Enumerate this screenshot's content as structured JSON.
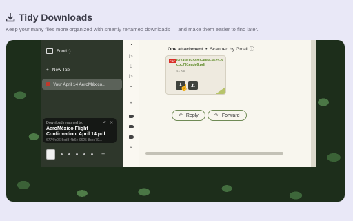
{
  "header": {
    "title": "Tidy Downloads",
    "subtitle": "Keep your many files more organized with smartly renamed downloads — and make them easier to find later.",
    "icon": "download-icon"
  },
  "sidebar": {
    "folder_label": "Food :)",
    "new_tab_label": "New Tab",
    "active_tab_label": "Your April 14 AeroMéxico..."
  },
  "toast": {
    "caption": "Download renamed to:",
    "title": "AeroMéxico Flight Confirmation, April 14.pdf",
    "original_name": "6774fe06-5cd3-4b6e-9625-8cbc79..."
  },
  "mail": {
    "attachment_heading": "One attachment",
    "scan_note": "Scanned by Gmail",
    "attachment_name": "6774fe06-5cd3-4b6e-9625-8cbc791eade6.pdf",
    "attachment_size": "41 KB",
    "file_type": "PDF",
    "reply_label": "Reply",
    "forward_label": "Forward"
  },
  "colors": {
    "page_bg": "#e9e8f7",
    "accent_green": "#5c8a25",
    "pill_border": "#6f8a55"
  }
}
